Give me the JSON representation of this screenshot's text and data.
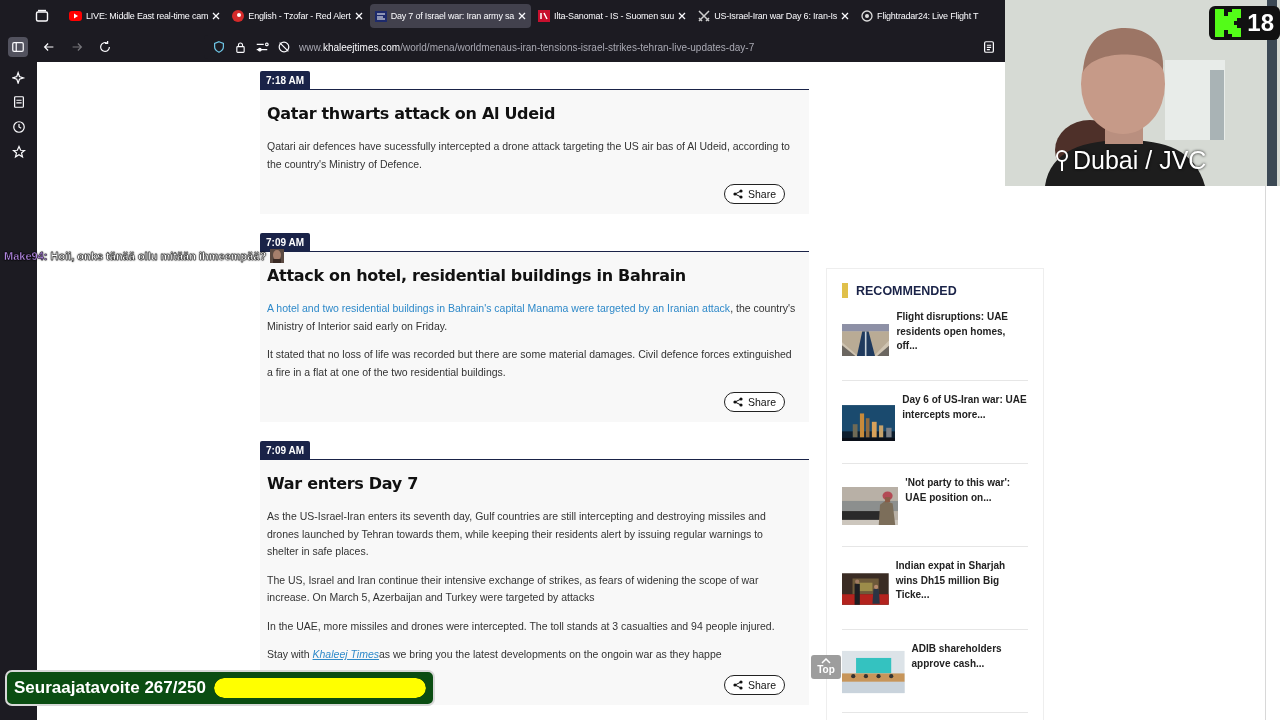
{
  "browser": {
    "tabs": [
      {
        "title": "LIVE: Middle East real-time cam",
        "selected": false,
        "closable": true
      },
      {
        "title": "English - Tzofar - Red Alert",
        "selected": false,
        "closable": true
      },
      {
        "title": "Day 7 of Israel war: Iran army sa",
        "selected": true,
        "closable": true
      },
      {
        "title": "Ilta-Sanomat - IS - Suomen suu",
        "selected": false,
        "closable": true
      },
      {
        "title": "US-Israel-Iran war Day 6: Iran-Is",
        "selected": false,
        "closable": true
      },
      {
        "title": "Flightradar24: Live Flight T",
        "selected": false,
        "closable": false
      }
    ],
    "address": {
      "url": "www.**khaleejtimes.com**/world/mena/worldmenaus-iran-tensions-israel-strikes-tehran-live-updates-day-7"
    }
  },
  "live_blog": {
    "entries": [
      {
        "time": "7:18 AM",
        "title": "Qatar thwarts attack on Al Udeid",
        "paragraphs": [
          [
            {
              "kind": "text",
              "text": "Qatari air defences have sucessfully intercepted a drone attack targeting the US air bas of Al Udeid, according to the country's Ministry of Defence."
            }
          ]
        ],
        "share": "Share"
      },
      {
        "time": "7:09 AM",
        "title": "Attack on hotel, residential buildings in Bahrain",
        "paragraphs": [
          [
            {
              "kind": "link",
              "text": "A hotel and two residential buildings in Bahrain's capital Manama were targeted by an Iranian attack"
            },
            {
              "kind": "text",
              "text": ", the country's Ministry of Interior said early on Friday."
            }
          ],
          [
            {
              "kind": "text",
              "text": "It stated that no loss of life was recorded but there are some material damages. Civil defence forces extinguished a fire in a flat at one of the two residential buildings."
            }
          ]
        ],
        "share": "Share"
      },
      {
        "time": "7:09 AM",
        "title": "War enters Day 7",
        "paragraphs": [
          [
            {
              "kind": "text",
              "text": "As the US-Israel-Iran enters its seventh day, Gulf countries are still intercepting and destroying missiles and drones launched by Tehran towards them, while keeping their residents alert by issuing regular warnings to shelter in safe places."
            }
          ],
          [
            {
              "kind": "text",
              "text": "The US, Israel and Iran continue their intensive exchange of strikes, as fears of widening the scope of war increase. On March 5, Azerbaijan and Turkey were targeted by attacks"
            }
          ],
          [
            {
              "kind": "text",
              "text": "In the UAE, more missiles and drones were intercepted. The toll stands at 3 casualties and 94 people injured."
            }
          ],
          [
            {
              "kind": "text",
              "text": "Stay with "
            },
            {
              "kind": "emphasis_link",
              "text": "Khaleej Times"
            },
            {
              "kind": "text",
              "text": "as we bring you the latest developments on the ongoin war as they happe"
            }
          ]
        ],
        "share": "Share"
      }
    ]
  },
  "recommended": {
    "heading": "RECOMMENDED",
    "items": [
      {
        "title": "Flight disruptions: UAE residents open homes, off..."
      },
      {
        "title": "Day 6 of US-Iran war: UAE intercepts more..."
      },
      {
        "title": "'Not party to this war': UAE position on..."
      },
      {
        "title": "Indian expat in Sharjah wins Dh15 million Big Ticke..."
      },
      {
        "title": "ADIB shareholders approve cash..."
      }
    ]
  },
  "stream_overlay": {
    "webcam": {
      "location": "Dubai / JVC",
      "viewers": "18"
    },
    "chat": {
      "user": "Make94:",
      "message": "Hoii, onks tänää ollu mitään ihmeempää?"
    },
    "follower_goal": {
      "label": "Seuraajatavoite 267/250",
      "level": 1
    },
    "scroll_top": "Top"
  }
}
